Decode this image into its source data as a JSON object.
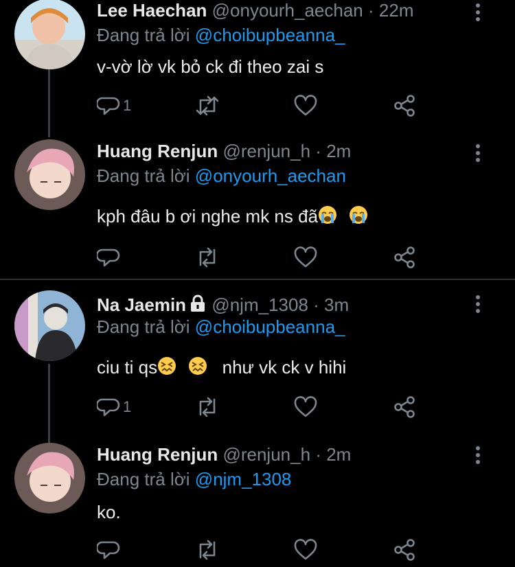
{
  "replies": [
    {
      "name": "Lee Haechan",
      "handle": "@onyourh_aechan",
      "separator": "·",
      "time": "22m",
      "reply_prefix": "Đang trả lời",
      "reply_to": "@choibupbeanna_",
      "text": "v-vờ lờ vk bỏ ck đi theo zai s",
      "emojis": [],
      "reply_count": "1",
      "avatar_colors": [
        "#c9e4f0",
        "#f1c2a7",
        "#d6d1c9"
      ]
    },
    {
      "name": "Huang Renjun",
      "handle": "@renjun_h",
      "separator": "·",
      "time": "2m",
      "reply_prefix": "Đang trả lời",
      "reply_to": "@onyourh_aechan",
      "text": "kph đâu b ơi nghe mk ns đã",
      "emojis": [
        "loudly-crying",
        "loudly-crying"
      ],
      "reply_count": "",
      "avatar_colors": [
        "#e8a7b4",
        "#f3d8cc",
        "#6b5a55"
      ]
    },
    {
      "name": "Na Jaemin",
      "handle": "@njm_1308",
      "separator": "·",
      "time": "3m",
      "reply_prefix": "Đang trả lời",
      "reply_to": "@choibupbeanna_",
      "text": "ciu ti qs",
      "text_tail": "như vk ck v hihi",
      "emojis": [
        "confounded",
        "confounded"
      ],
      "reply_count": "1",
      "locked": true,
      "avatar_colors": [
        "#8fb4d6",
        "#2a2a2e",
        "#e6e0da"
      ]
    },
    {
      "name": "Huang Renjun",
      "handle": "@renjun_h",
      "separator": "·",
      "time": "2m",
      "reply_prefix": "Đang trả lời",
      "reply_to": "@njm_1308",
      "text": "ko.",
      "emojis": [],
      "reply_count": "",
      "avatar_colors": [
        "#e8a7b4",
        "#f3d8cc",
        "#6b5a55"
      ]
    }
  ],
  "icons": {
    "reply": "reply-icon",
    "retweet": "retweet-icon",
    "like": "heart-icon",
    "share": "share-icon",
    "more": "more-icon",
    "lock": "lock-icon"
  },
  "colors": {
    "background": "#000000",
    "mention": "#1d9bf0",
    "muted": "#7d8790",
    "divider": "#2f3336"
  }
}
